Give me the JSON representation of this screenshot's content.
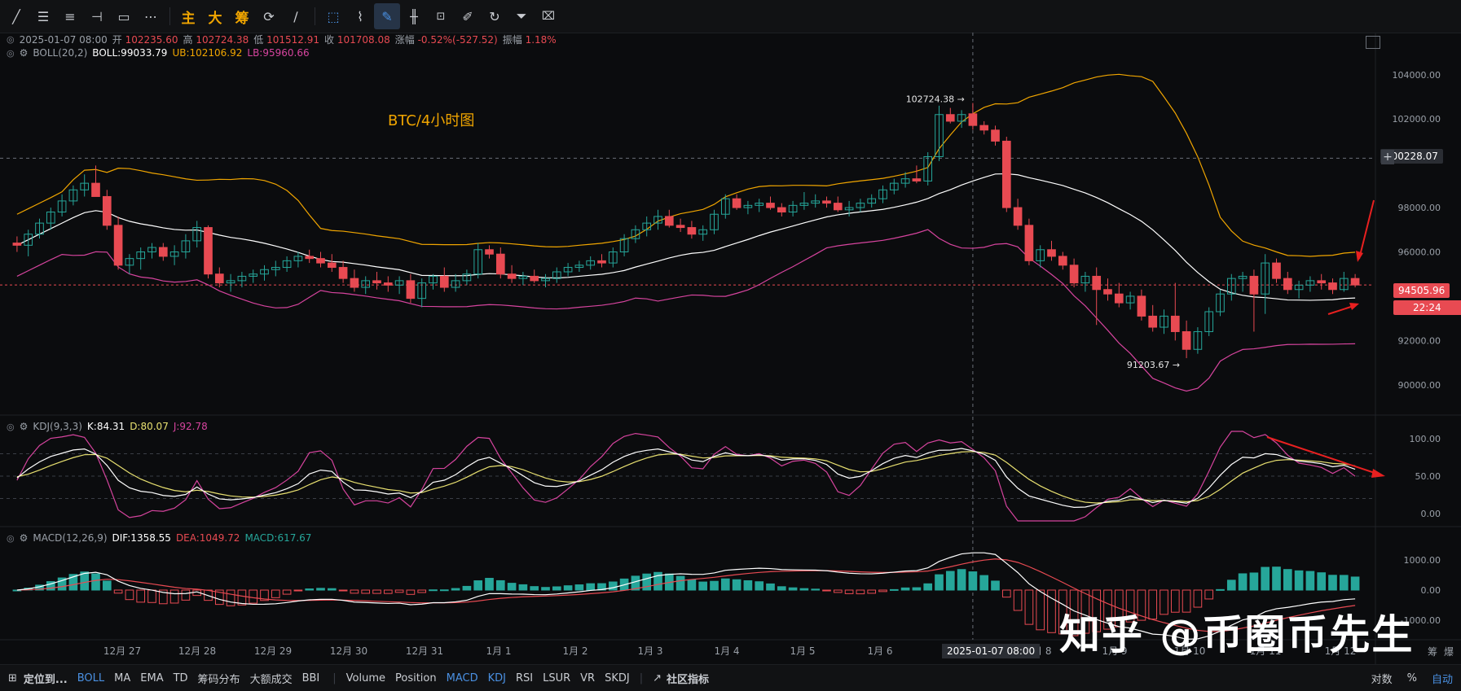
{
  "toolbar": {
    "tools": [
      {
        "name": "trend-line-icon",
        "glyph": "╱"
      },
      {
        "name": "parallel-lines-icon",
        "glyph": "☰"
      },
      {
        "name": "horizontal-ray-icon",
        "glyph": "≡"
      },
      {
        "name": "cross-line-icon",
        "glyph": "⊣"
      },
      {
        "name": "rectangle-icon",
        "glyph": "▭"
      },
      {
        "name": "dots-icon",
        "glyph": "⋯"
      }
    ],
    "cn_tools": [
      "主",
      "大",
      "筹"
    ],
    "tools2": [
      {
        "name": "rotate-icon",
        "glyph": "⟳"
      },
      {
        "name": "brush-icon",
        "glyph": "∕"
      },
      {
        "name": "select-icon",
        "glyph": "⬚"
      },
      {
        "name": "ruler-icon",
        "glyph": "⌇"
      },
      {
        "name": "pencil-icon",
        "glyph": "✎"
      },
      {
        "name": "candle-tool-icon",
        "glyph": "╫"
      },
      {
        "name": "lock-icon",
        "glyph": "🔒"
      },
      {
        "name": "note-icon",
        "glyph": "✐"
      },
      {
        "name": "magnet-icon",
        "glyph": "↻"
      },
      {
        "name": "filter-icon",
        "glyph": "⏷"
      },
      {
        "name": "trash-icon",
        "glyph": "🗑"
      }
    ]
  },
  "ohlc": {
    "date": "2025-01-07 08:00",
    "open_label": "开",
    "open": "102235.60",
    "high_label": "高",
    "high": "102724.38",
    "low_label": "低",
    "low": "101512.91",
    "close_label": "收",
    "close": "101708.08",
    "change_label": "涨幅",
    "change": "-0.52%(-527.52)",
    "amp_label": "振幅",
    "amp": "1.18%"
  },
  "boll": {
    "name": "BOLL(20,2)",
    "mid": "BOLL:99033.79",
    "ub": "UB:102106.92",
    "lb": "LB:95960.66"
  },
  "kdj": {
    "name": "KDJ(9,3,3)",
    "k": "K:84.31",
    "d": "D:80.07",
    "j": "J:92.78"
  },
  "macd": {
    "name": "MACD(12,26,9)",
    "dif": "DIF:1358.55",
    "dea": "DEA:1049.72",
    "macd": "MACD:617.67"
  },
  "chart_title": "BTC/4小时图",
  "price_axis": [
    "104000.00",
    "102000.00",
    "100228.07",
    "98000.00",
    "96000.00",
    "94505.96",
    "22:24",
    "92000.00",
    "90000.00"
  ],
  "price_tags": {
    "crosshair": "100228.07",
    "current": "94505.96",
    "countdown": "22:24"
  },
  "kdj_axis": [
    "100.00",
    "50.00",
    "0.00"
  ],
  "macd_axis": [
    "1000.00",
    "0.00",
    "-1000.00"
  ],
  "annotations": {
    "high": "102724.38",
    "low": "91203.67"
  },
  "time_axis": [
    "12月 27",
    "12月 28",
    "12月 29",
    "12月 30",
    "12月 31",
    "1月 1",
    "1月 2",
    "1月 3",
    "1月 4",
    "1月 5",
    "1月 6",
    "1月 8",
    "1月 9",
    "1月 10",
    "1月 11",
    "1月 12"
  ],
  "crosshair_time": "2025-01-07 08:00",
  "right_axis_labels": {
    "chip": "筹",
    "burst": "爆"
  },
  "bottombar": {
    "locate": "定位到...",
    "indicators": [
      "BOLL",
      "MA",
      "EMA",
      "TD",
      "筹码分布",
      "大额成交",
      "BBI"
    ],
    "sub_indicators": [
      "Volume",
      "Position",
      "MACD",
      "KDJ",
      "RSI",
      "LSUR",
      "VR",
      "SKDJ"
    ],
    "community": "社区指标",
    "right": [
      "对数",
      "%",
      "自动"
    ]
  },
  "watermark": "知乎 @币圈币先生",
  "colors": {
    "up": "#26a69a",
    "down": "#e84a52",
    "mid": "#ffffff",
    "ub": "#f0a500",
    "lb": "#d6449e",
    "k": "#ffffff",
    "d": "#e8e070",
    "j": "#d6449e",
    "accent": "#4a90e2"
  },
  "chart_data": {
    "type": "candlestick",
    "interval": "4h",
    "y_range": [
      89000,
      104800
    ],
    "start": "2024-12-26 12:00",
    "candles": [
      [
        96400,
        96700,
        96000,
        96300
      ],
      [
        96300,
        97000,
        95800,
        96800
      ],
      [
        96800,
        97500,
        96600,
        97300
      ],
      [
        97300,
        98000,
        97000,
        97800
      ],
      [
        97800,
        98600,
        97600,
        98300
      ],
      [
        98300,
        99000,
        98100,
        98800
      ],
      [
        98800,
        99500,
        98500,
        99100
      ],
      [
        99100,
        99900,
        98700,
        98500
      ],
      [
        98500,
        98800,
        97000,
        97200
      ],
      [
        97200,
        97600,
        95200,
        95400
      ],
      [
        95400,
        95900,
        95000,
        95700
      ],
      [
        95700,
        96200,
        95200,
        96000
      ],
      [
        96000,
        96400,
        95700,
        96200
      ],
      [
        96200,
        96400,
        95600,
        95800
      ],
      [
        95800,
        96300,
        95400,
        96000
      ],
      [
        96000,
        96800,
        95700,
        96500
      ],
      [
        96500,
        97400,
        96200,
        97100
      ],
      [
        97100,
        97200,
        94800,
        95000
      ],
      [
        95000,
        95300,
        94400,
        94600
      ],
      [
        94600,
        95000,
        94200,
        94700
      ],
      [
        94700,
        95100,
        94400,
        94900
      ],
      [
        94900,
        95200,
        94600,
        95000
      ],
      [
        95000,
        95400,
        94700,
        95200
      ],
      [
        95200,
        95600,
        94900,
        95300
      ],
      [
        95300,
        95800,
        95100,
        95600
      ],
      [
        95600,
        96000,
        95300,
        95800
      ],
      [
        95800,
        96100,
        95500,
        95700
      ],
      [
        95700,
        96000,
        95300,
        95500
      ],
      [
        95500,
        95900,
        95100,
        95300
      ],
      [
        95300,
        95600,
        94600,
        94800
      ],
      [
        94800,
        95200,
        94200,
        94400
      ],
      [
        94400,
        94900,
        94100,
        94700
      ],
      [
        94700,
        95100,
        94300,
        94600
      ],
      [
        94600,
        94900,
        94200,
        94500
      ],
      [
        94500,
        94900,
        94100,
        94700
      ],
      [
        94700,
        95000,
        93700,
        93900
      ],
      [
        93900,
        94800,
        93500,
        94600
      ],
      [
        94600,
        95000,
        94300,
        94900
      ],
      [
        94900,
        95300,
        94200,
        94400
      ],
      [
        94400,
        95000,
        94200,
        94700
      ],
      [
        94700,
        95200,
        94500,
        95000
      ],
      [
        95000,
        96400,
        94800,
        96100
      ],
      [
        96100,
        96300,
        95700,
        95900
      ],
      [
        95900,
        96200,
        94800,
        95000
      ],
      [
        95000,
        95400,
        94600,
        94800
      ],
      [
        94800,
        95100,
        94500,
        94900
      ],
      [
        94900,
        95200,
        94600,
        94700
      ],
      [
        94700,
        95000,
        94400,
        94800
      ],
      [
        94800,
        95300,
        94600,
        95100
      ],
      [
        95100,
        95500,
        94900,
        95300
      ],
      [
        95300,
        95600,
        95100,
        95400
      ],
      [
        95400,
        95800,
        95200,
        95600
      ],
      [
        95600,
        95900,
        95300,
        95500
      ],
      [
        95500,
        96200,
        95300,
        96000
      ],
      [
        96000,
        96800,
        95800,
        96600
      ],
      [
        96600,
        97200,
        96400,
        97000
      ],
      [
        97000,
        97600,
        96700,
        97300
      ],
      [
        97300,
        97900,
        97000,
        97600
      ],
      [
        97600,
        97900,
        97100,
        97200
      ],
      [
        97200,
        97500,
        96900,
        97100
      ],
      [
        97100,
        97400,
        96600,
        96800
      ],
      [
        96800,
        97200,
        96500,
        97000
      ],
      [
        97000,
        97900,
        96800,
        97700
      ],
      [
        97700,
        98600,
        97500,
        98400
      ],
      [
        98400,
        98600,
        97900,
        98000
      ],
      [
        98000,
        98300,
        97700,
        98100
      ],
      [
        98100,
        98400,
        97800,
        98200
      ],
      [
        98200,
        98500,
        97900,
        98000
      ],
      [
        98000,
        98200,
        97600,
        97800
      ],
      [
        97800,
        98300,
        97600,
        98100
      ],
      [
        98100,
        98700,
        97900,
        98200
      ],
      [
        98200,
        98600,
        98000,
        98300
      ],
      [
        98300,
        98500,
        98000,
        98200
      ],
      [
        98200,
        98500,
        97800,
        97900
      ],
      [
        97900,
        98300,
        97600,
        98000
      ],
      [
        98000,
        98400,
        97800,
        98200
      ],
      [
        98200,
        98600,
        98000,
        98400
      ],
      [
        98400,
        99000,
        98200,
        98800
      ],
      [
        98800,
        99300,
        98600,
        99100
      ],
      [
        99100,
        99600,
        98900,
        99300
      ],
      [
        99300,
        99900,
        99100,
        99200
      ],
      [
        99200,
        100500,
        99000,
        100300
      ],
      [
        100300,
        102600,
        100100,
        102200
      ],
      [
        102200,
        102500,
        101800,
        101900
      ],
      [
        101900,
        102400,
        101600,
        102200
      ],
      [
        102235,
        102724,
        101512,
        101708
      ],
      [
        101708,
        101900,
        101300,
        101500
      ],
      [
        101500,
        101700,
        100800,
        101000
      ],
      [
        101000,
        101200,
        97800,
        98000
      ],
      [
        98000,
        98400,
        97000,
        97200
      ],
      [
        97200,
        97500,
        95400,
        95600
      ],
      [
        95600,
        96300,
        95300,
        96100
      ],
      [
        96100,
        96500,
        95600,
        95800
      ],
      [
        95800,
        96000,
        95200,
        95400
      ],
      [
        95400,
        95700,
        94400,
        94600
      ],
      [
        94600,
        95100,
        94200,
        94900
      ],
      [
        94900,
        95300,
        92700,
        94300
      ],
      [
        94300,
        94800,
        93800,
        94100
      ],
      [
        94100,
        94600,
        93500,
        93700
      ],
      [
        93700,
        94200,
        93400,
        94000
      ],
      [
        94000,
        94300,
        92900,
        93100
      ],
      [
        93100,
        93600,
        92400,
        92600
      ],
      [
        92600,
        93400,
        92300,
        93100
      ],
      [
        93100,
        94600,
        92000,
        92400
      ],
      [
        92400,
        92900,
        91203,
        91600
      ],
      [
        91600,
        92600,
        91400,
        92400
      ],
      [
        92400,
        93500,
        92200,
        93300
      ],
      [
        93300,
        94300,
        93100,
        94100
      ],
      [
        94100,
        95000,
        93800,
        94800
      ],
      [
        94800,
        95100,
        94200,
        94900
      ],
      [
        94900,
        95200,
        92400,
        94100
      ],
      [
        94100,
        95900,
        93200,
        95500
      ],
      [
        95500,
        95700,
        94600,
        94800
      ],
      [
        94800,
        95100,
        94100,
        94300
      ],
      [
        94300,
        94700,
        93900,
        94500
      ],
      [
        94500,
        94900,
        94200,
        94700
      ],
      [
        94700,
        95000,
        94300,
        94600
      ],
      [
        94600,
        94800,
        94100,
        94300
      ],
      [
        94300,
        95100,
        94200,
        94800
      ],
      [
        94800,
        95000,
        94400,
        94506
      ]
    ]
  }
}
